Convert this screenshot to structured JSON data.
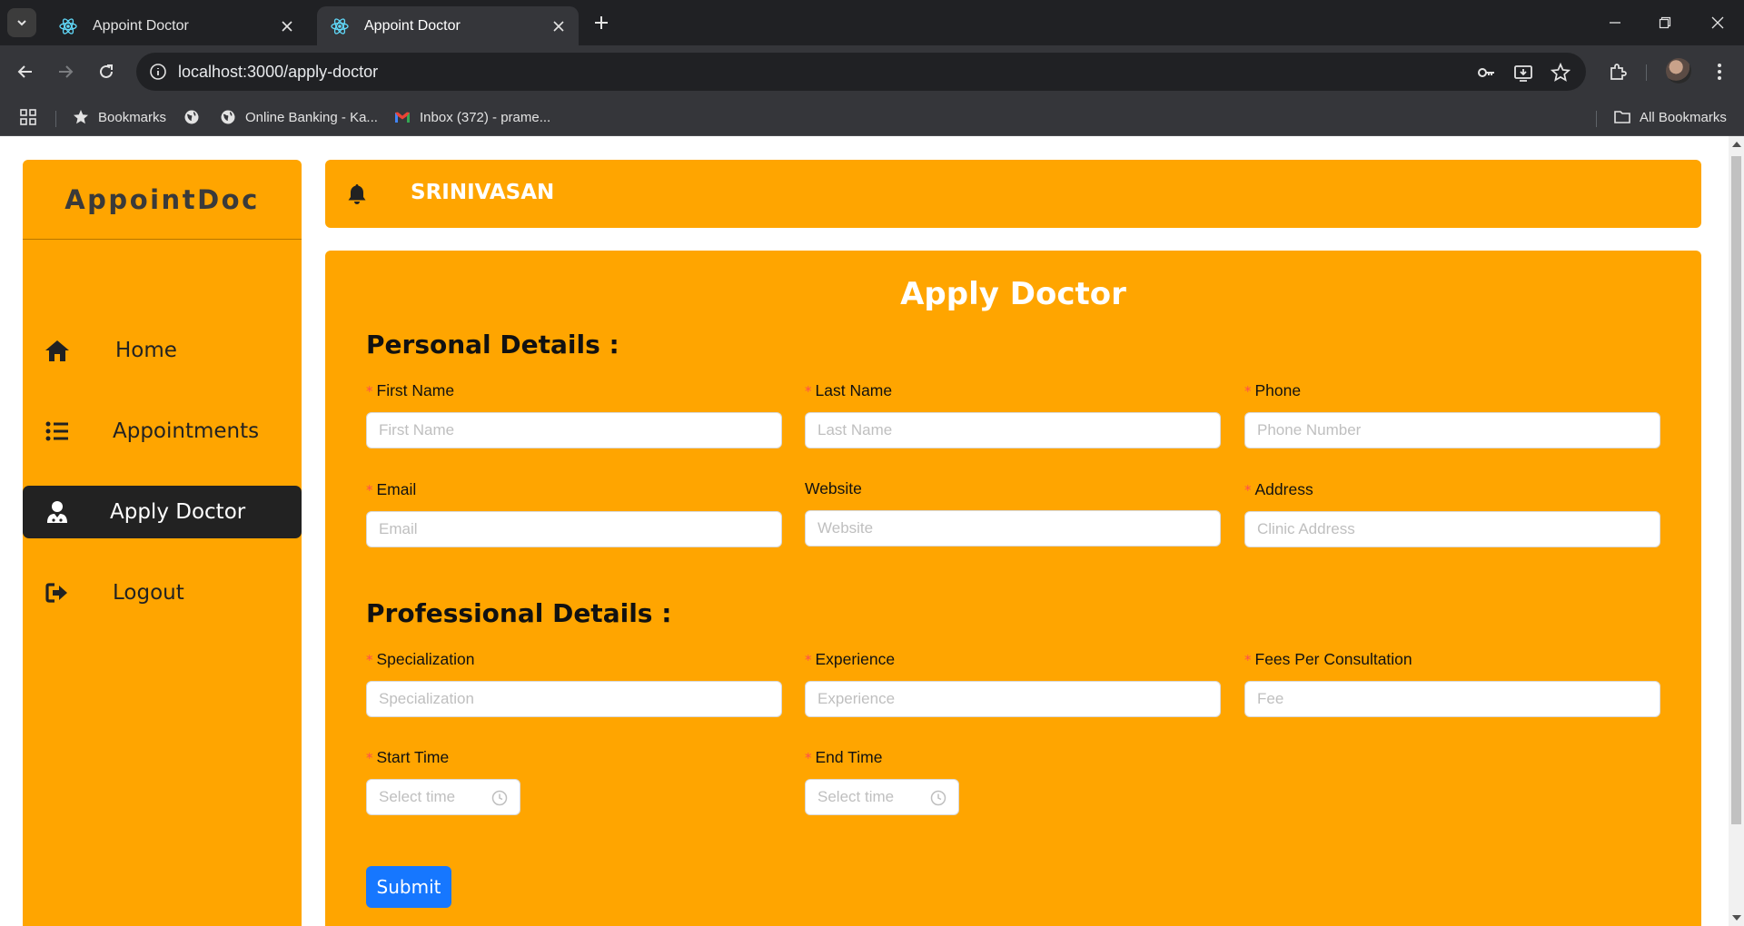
{
  "browser": {
    "tabs": [
      {
        "title": "Appoint Doctor",
        "active": false
      },
      {
        "title": "Appoint Doctor",
        "active": true
      }
    ],
    "url": "localhost:3000/apply-doctor",
    "bookmarks": [
      {
        "label": "Bookmarks",
        "icon": "star-icon"
      },
      {
        "label": "",
        "icon": "globe-icon"
      },
      {
        "label": "Online Banking - Ka...",
        "icon": "globe-icon"
      },
      {
        "label": "Inbox (372) - prame...",
        "icon": "gmail-icon"
      }
    ],
    "all_bookmarks": "All Bookmarks"
  },
  "app": {
    "logo": "AppointDoc",
    "menu": [
      {
        "label": "Home",
        "icon": "home-icon",
        "active": false
      },
      {
        "label": "Appointments",
        "icon": "list-icon",
        "active": false
      },
      {
        "label": "Apply Doctor",
        "icon": "user-doctor-icon",
        "active": true
      },
      {
        "label": "Logout",
        "icon": "logout-icon",
        "active": false
      }
    ],
    "username": "SRINIVASAN"
  },
  "form": {
    "title": "Apply Doctor",
    "personal_title": "Personal Details :",
    "professional_title": "Professional Details :",
    "fields": {
      "first_name": {
        "label": "First Name",
        "placeholder": "First Name",
        "required": true,
        "value": ""
      },
      "last_name": {
        "label": "Last Name",
        "placeholder": "Last Name",
        "required": true,
        "value": ""
      },
      "phone": {
        "label": "Phone",
        "placeholder": "Phone Number",
        "required": true,
        "value": ""
      },
      "email": {
        "label": "Email",
        "placeholder": "Email",
        "required": true,
        "value": ""
      },
      "website": {
        "label": "Website",
        "placeholder": "Website",
        "required": false,
        "value": ""
      },
      "address": {
        "label": "Address",
        "placeholder": "Clinic Address",
        "required": true,
        "value": ""
      },
      "specialization": {
        "label": "Specialization",
        "placeholder": "Specialization",
        "required": true,
        "value": ""
      },
      "experience": {
        "label": "Experience",
        "placeholder": "Experience",
        "required": true,
        "value": ""
      },
      "fees": {
        "label": "Fees Per Consultation",
        "placeholder": "Fee",
        "required": true,
        "value": ""
      },
      "start_time": {
        "label": "Start Time",
        "placeholder": "Select time",
        "required": true,
        "value": ""
      },
      "end_time": {
        "label": "End Time",
        "placeholder": "Select time",
        "required": true,
        "value": ""
      }
    },
    "required_mark": "*",
    "submit_label": "Submit"
  },
  "colors": {
    "accent": "#ffa500",
    "primary_button": "#1677ff",
    "required": "#ff4d4f",
    "active_menu": "#222222"
  }
}
